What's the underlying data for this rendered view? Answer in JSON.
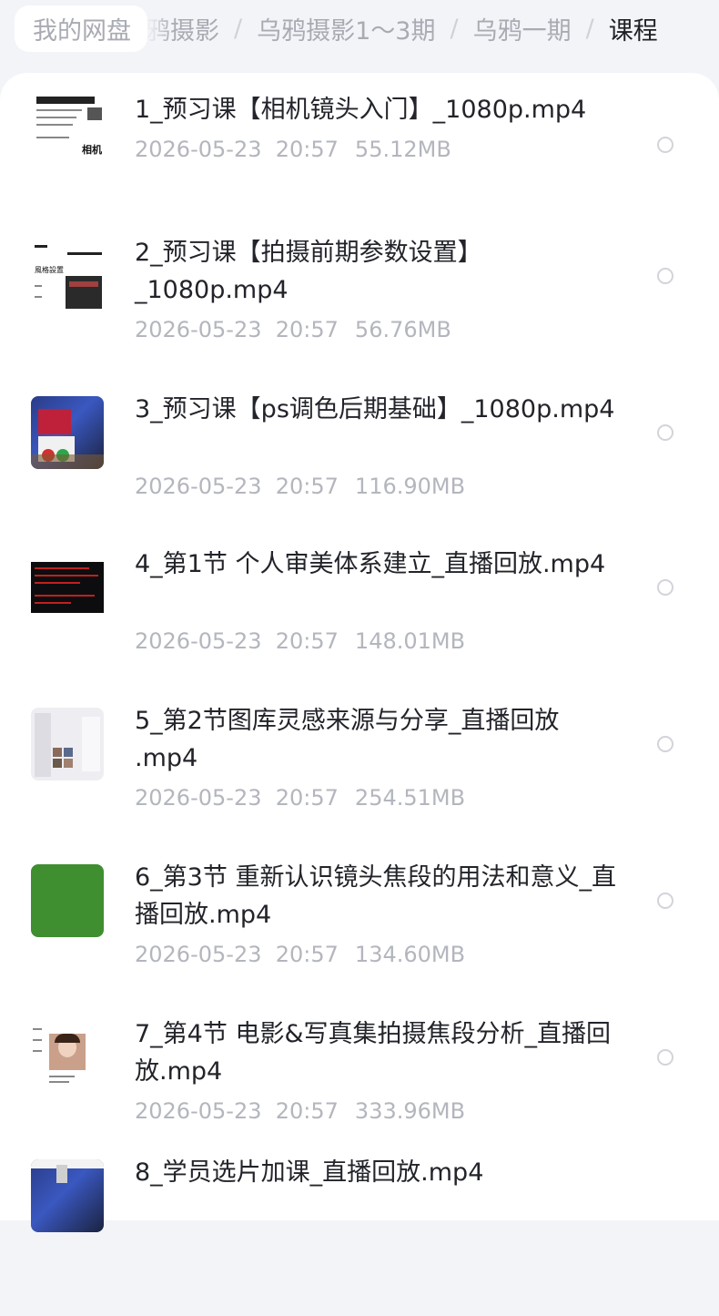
{
  "breadcrumb": {
    "root": "我的网盘",
    "items": [
      "鸦摄影",
      "乌鸦摄影1～3期",
      "乌鸦一期",
      "课程"
    ],
    "separator": "/"
  },
  "files": [
    {
      "title": "1_预习课【相机镜头入门】_1080p.mp4",
      "date": "2026-05-23",
      "time": "20:57",
      "size": "55.12MB",
      "thumb": "document-thumbnail",
      "thumb_text": "相机"
    },
    {
      "title": "2_预习课【拍摄前期参数设置】_1080p.mp4",
      "date": "2026-05-23",
      "time": "20:57",
      "size": "56.76MB",
      "thumb": "settings-thumbnail",
      "thumb_text": "風格設置"
    },
    {
      "title": "3_预习课【ps调色后期基础】_1080p.mp4",
      "date": "2026-05-23",
      "time": "20:57",
      "size": "116.90MB",
      "thumb": "photo-thumbnail"
    },
    {
      "title": "4_第1节 个人审美体系建立_直播回放.mp4",
      "date": "2026-05-23",
      "time": "20:57",
      "size": "148.01MB",
      "thumb": "dark-text-thumbnail"
    },
    {
      "title": "5_第2节图库灵感来源与分享_直播回放 .mp4",
      "date": "2026-05-23",
      "time": "20:57",
      "size": "254.51MB",
      "thumb": "gallery-thumbnail"
    },
    {
      "title": "6_第3节 重新认识镜头焦段的用法和意义_直播回放.mp4",
      "date": "2026-05-23",
      "time": "20:57",
      "size": "134.60MB",
      "thumb": "green-thumbnail"
    },
    {
      "title": "7_第4节 电影&写真集拍摄焦段分析_直播回放.mp4",
      "date": "2026-05-23",
      "time": "20:57",
      "size": "333.96MB",
      "thumb": "portrait-thumbnail"
    },
    {
      "title": "8_学员选片加课_直播回放.mp4",
      "date": "",
      "time": "",
      "size": "",
      "thumb": "photo-thumbnail"
    }
  ],
  "colors": {
    "accent_text": "#22242a",
    "meta_text": "#b3b6bd",
    "background": "#f3f4f8",
    "card": "#ffffff"
  }
}
